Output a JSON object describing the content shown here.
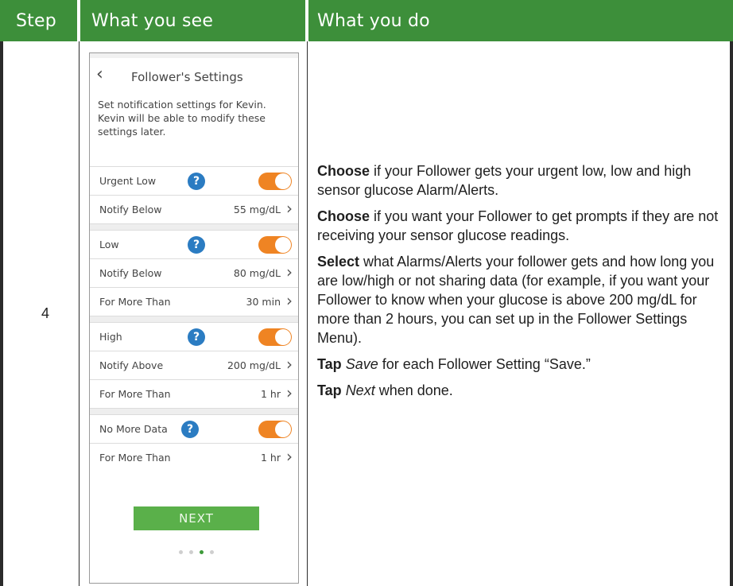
{
  "table": {
    "headers": {
      "step": "Step",
      "see": "What you see",
      "do": "What you do"
    },
    "step_number": "4"
  },
  "phone": {
    "title": "Follower's Settings",
    "intro": "Set notification settings for Kevin. Kevin will be able to modify these settings later.",
    "rows": [
      {
        "label": "Urgent Low",
        "help": "?"
      },
      {
        "label": "Notify Below",
        "value": "55 mg/dL"
      },
      {
        "label": "Low",
        "help": "?"
      },
      {
        "label": "Notify Below",
        "value": "80 mg/dL"
      },
      {
        "label": "For More Than",
        "value": "30 min"
      },
      {
        "label": "High",
        "help": "?"
      },
      {
        "label": "Notify Above",
        "value": "200 mg/dL"
      },
      {
        "label": "For More Than",
        "value": "1 hr"
      },
      {
        "label": "No More Data",
        "help": "?"
      },
      {
        "label": "For More Than",
        "value": "1 hr"
      }
    ],
    "next_label": "NEXT",
    "page_dots": {
      "count": 4,
      "active_index": 2
    },
    "toggle_color": "#ef8423"
  },
  "instructions": {
    "p1_bold": "Choose",
    "p1_text": " if your Follower gets your urgent low, low and high sensor glucose Alarm/Alerts.",
    "p2_bold": "Choose",
    "p2_text": " if you want your Follower to get prompts if they are not receiving your sensor glucose readings.",
    "p3_bold": "Select",
    "p3_text": " what Alarms/Alerts your follower gets and how long you are low/high or not sharing data (for example, if you want your Follower to know when your glucose is above 200 mg/dL for more than 2 hours, you can set up in the Follower Settings Menu).",
    "p4_bold": "Tap",
    "p4_italic": "Save",
    "p4_text": " for each Follower Setting “Save.”",
    "p5_bold": "Tap",
    "p5_italic": "Next",
    "p5_text": " when done."
  },
  "colors": {
    "header_bg": "#3d8f3a",
    "help_icon": "#2b7cc2",
    "next_button": "#5ab04a"
  }
}
